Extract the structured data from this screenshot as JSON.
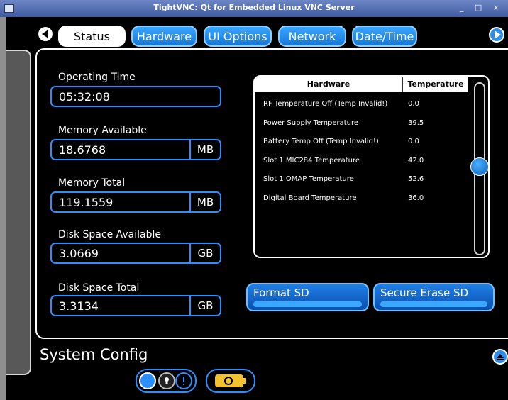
{
  "window": {
    "title": "TightVNC: Qt for Embedded Linux VNC Server",
    "controls": "_ □ ×"
  },
  "tabs": [
    {
      "label": "Status",
      "active": true
    },
    {
      "label": "Hardware",
      "active": false
    },
    {
      "label": "UI Options",
      "active": false
    },
    {
      "label": "Network",
      "active": false
    },
    {
      "label": "Date/Time",
      "active": false
    }
  ],
  "status": {
    "operating_time": {
      "label": "Operating Time",
      "value": "05:32:08"
    },
    "memory_available": {
      "label": "Memory Available",
      "value": "18.6768",
      "unit": "MB"
    },
    "memory_total": {
      "label": "Memory Total",
      "value": "119.1559",
      "unit": "MB"
    },
    "disk_available": {
      "label": "Disk Space Available",
      "value": "3.0669",
      "unit": "GB"
    },
    "disk_total": {
      "label": "Disk Space Total",
      "value": "3.3134",
      "unit": "GB"
    }
  },
  "temperature_table": {
    "columns": [
      "Hardware",
      "Temperature"
    ],
    "rows": [
      {
        "hardware": "RF Temperature Off (Temp Invalid!)",
        "temperature": "0.0"
      },
      {
        "hardware": "Power Supply Temperature",
        "temperature": "39.5"
      },
      {
        "hardware": "Battery Temp Off (Temp Invalid!)",
        "temperature": "0.0"
      },
      {
        "hardware": "Slot 1 MIC284 Temperature",
        "temperature": "42.0"
      },
      {
        "hardware": "Slot 1 OMAP Temperature",
        "temperature": "52.6"
      },
      {
        "hardware": "Digital Board Temperature",
        "temperature": "36.0"
      }
    ],
    "scroll_position": 0.5
  },
  "buttons": {
    "format_sd": "Format SD",
    "secure_erase_sd": "Secure Erase SD"
  },
  "section": {
    "title": "System Config"
  },
  "icons": {
    "prev": "arrow-left-icon",
    "next": "arrow-right-icon",
    "collapse": "eject-up-icon",
    "lock": "lock-icon",
    "info": "info-icon",
    "power": "power-plug-icon"
  },
  "colors": {
    "accent": "#2b8fff",
    "background": "#000000",
    "titlebar": "#4f68ad",
    "power": "#f2c230"
  }
}
